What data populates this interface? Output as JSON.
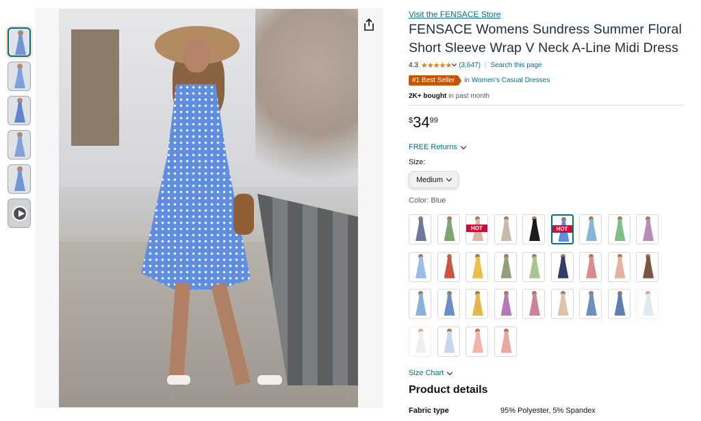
{
  "thumbnails": [
    {
      "name": "thumb-1",
      "color": "#6f95d6",
      "active": true
    },
    {
      "name": "thumb-2",
      "color": "#7ca0dd",
      "active": false
    },
    {
      "name": "thumb-3",
      "color": "#5f86cc",
      "active": false
    },
    {
      "name": "thumb-4",
      "color": "#7fa3d8",
      "active": false
    },
    {
      "name": "thumb-5",
      "color": "#6f95d6",
      "active": false
    },
    {
      "name": "thumb-video",
      "video": true
    }
  ],
  "store_link": "Visit the FENSACE Store",
  "title": "FENSACE Womens Sundress Summer Floral Short Sleeve Wrap V Neck A-Line Midi Dress",
  "rating": {
    "value": "4.3",
    "stars": "★★★★★",
    "count": "(3,647)",
    "separator": "|",
    "search": "Search this page"
  },
  "badge": {
    "label": "#1 Best Seller",
    "category": "in Women's Casual Dresses"
  },
  "bought": {
    "count": "2K+ bought",
    "period": "in past month"
  },
  "price": {
    "symbol": "$",
    "whole": "34",
    "fraction": "99"
  },
  "returns": "FREE Returns",
  "size": {
    "label": "Size:",
    "selected": "Medium"
  },
  "color": {
    "label": "Color:",
    "selected": "Blue"
  },
  "swatches": [
    {
      "color": "#6b7a99",
      "hot": false
    },
    {
      "color": "#7fa26f",
      "hot": false
    },
    {
      "color": "#d8b7a8",
      "hot": true
    },
    {
      "color": "#c8b9a8",
      "hot": false
    },
    {
      "color": "#1c1c1c",
      "hot": false
    },
    {
      "color": "#5f8de0",
      "hot": true,
      "selected": true
    },
    {
      "color": "#86b5d8",
      "hot": false
    },
    {
      "color": "#7fbf86",
      "hot": false
    },
    {
      "color": "#b88bb8",
      "hot": false
    },
    {
      "color": "#9cbbe6",
      "hot": false
    },
    {
      "color": "#c9573f",
      "hot": false
    },
    {
      "color": "#e8c04a",
      "hot": false
    },
    {
      "color": "#8fa07a",
      "hot": false
    },
    {
      "color": "#a5c78f",
      "hot": false
    },
    {
      "color": "#2d3e6a",
      "hot": false
    },
    {
      "color": "#d98b8b",
      "hot": false
    },
    {
      "color": "#e3b3a0",
      "hot": false
    },
    {
      "color": "#7a5540",
      "hot": false
    },
    {
      "color": "#8db0d8",
      "hot": false
    },
    {
      "color": "#6e8fc4",
      "hot": false
    },
    {
      "color": "#e2b84b",
      "hot": false
    },
    {
      "color": "#b57ab5",
      "hot": false
    },
    {
      "color": "#c9839c",
      "hot": false
    },
    {
      "color": "#e0c3a6",
      "hot": false
    },
    {
      "color": "#6c8fbf",
      "hot": false
    },
    {
      "color": "#5d7fb0",
      "hot": false
    },
    {
      "color": "#d3dbe6",
      "hot": false,
      "na": true
    },
    {
      "color": "#e5e5e5",
      "hot": false,
      "na": true
    },
    {
      "color": "#c7d6ea",
      "hot": false
    },
    {
      "color": "#f0b4a8",
      "hot": false
    },
    {
      "color": "#e9a7a0",
      "hot": false
    }
  ],
  "hot_label": "HOT",
  "size_chart": "Size Chart",
  "product_details": {
    "title": "Product details",
    "fabric_key": "Fabric type",
    "fabric_value": "95% Polyester, 5% Spandex"
  }
}
